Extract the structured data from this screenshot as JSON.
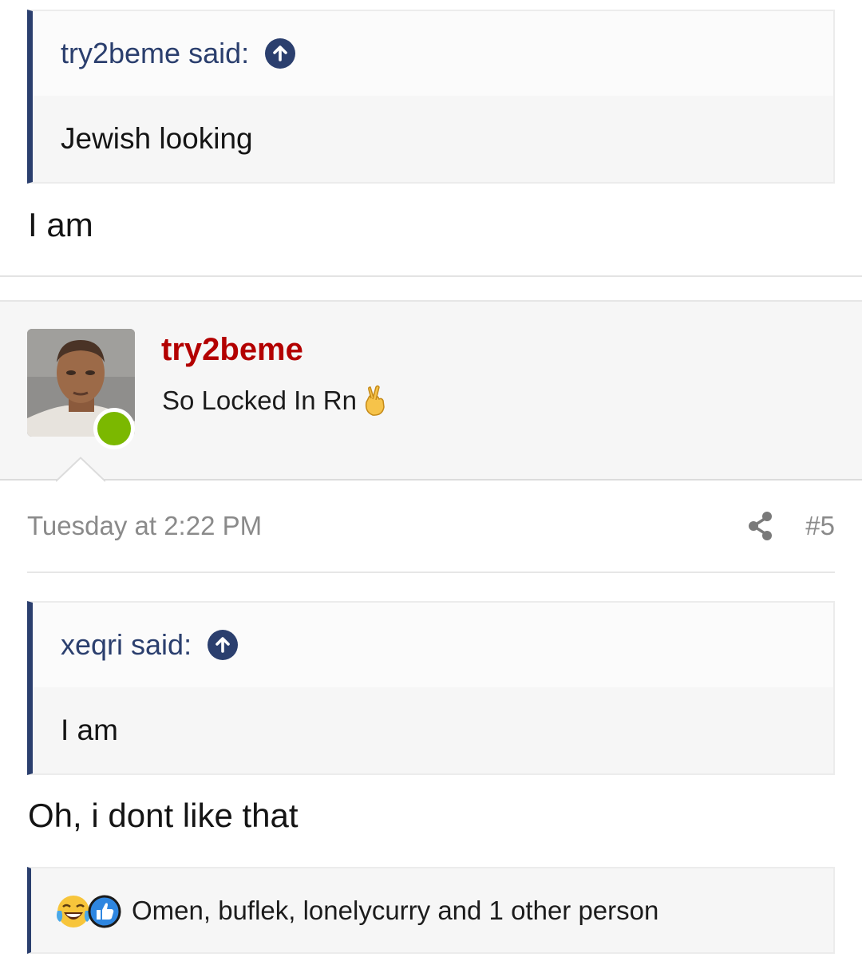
{
  "post1": {
    "quote": {
      "author": "try2beme",
      "said_label": "try2beme said:",
      "text": "Jewish looking"
    },
    "reply": "I am"
  },
  "post2": {
    "author": {
      "username": "try2beme",
      "title": "So Locked In Rn",
      "status": "online",
      "title_emoji": "fingers-crossed",
      "status_color": "#7bb800"
    },
    "date": "Tuesday at 2:22 PM",
    "post_number": "#5",
    "quote": {
      "author": "xeqri",
      "said_label": "xeqri said:",
      "text": "I am"
    },
    "reply": "Oh, i dont like that",
    "reactions": {
      "icons": [
        "laughing-crying-icon",
        "thumbs-up-icon"
      ],
      "summary": "Omen, buflek, lonelycurry and 1 other person"
    }
  },
  "colors": {
    "accent": "#2b3f6e",
    "username": "#b30000",
    "muted": "#8a8a8a"
  }
}
